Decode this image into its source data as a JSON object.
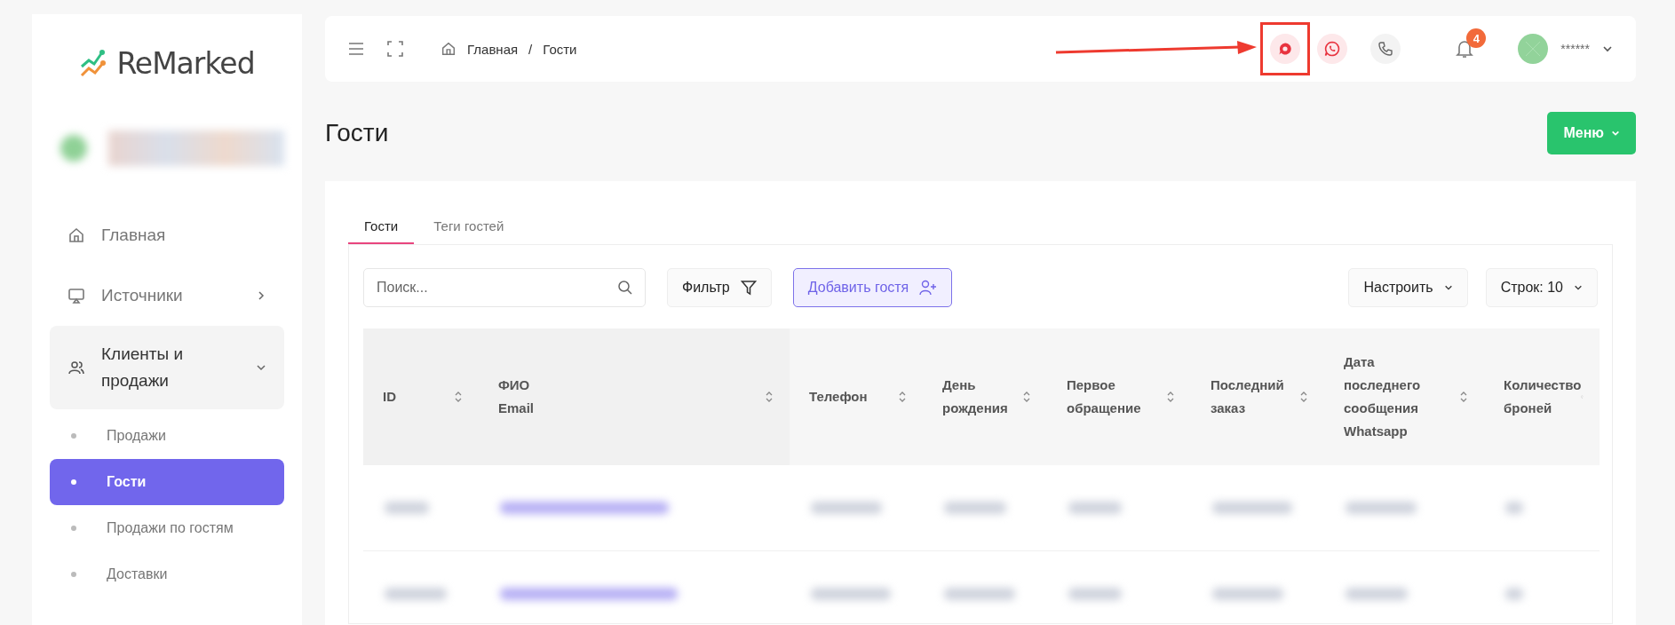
{
  "sidebar": {
    "logo": "ReMarked",
    "items": [
      {
        "label": "Главная",
        "kind": "home",
        "expanded": false
      },
      {
        "label": "Источники",
        "kind": "sources",
        "expanded": false
      },
      {
        "label": "Клиенты и продажи",
        "kind": "clients",
        "expanded": true,
        "children": [
          {
            "label": "Продажи",
            "selected": false
          },
          {
            "label": "Гости",
            "selected": true
          },
          {
            "label": "Продажи по гостям",
            "selected": false
          },
          {
            "label": "Доставки",
            "selected": false
          }
        ]
      }
    ]
  },
  "header": {
    "breadcrumbs": [
      "Главная",
      "Гости"
    ],
    "breadcrumb_separator": "/",
    "notification_count": "4",
    "user_name": "******"
  },
  "page": {
    "title": "Гости",
    "menu_button": "Меню"
  },
  "tabs": [
    {
      "label": "Гости",
      "selected": true
    },
    {
      "label": "Теги гостей",
      "selected": false
    }
  ],
  "toolbar": {
    "search_placeholder": "Поиск...",
    "filter": "Фильтр",
    "add_guest": "Добавить гостя",
    "configure": "Настроить",
    "rows_label": "Строк:",
    "rows_value": "10"
  },
  "table": {
    "columns": [
      {
        "lines": [
          "ID"
        ]
      },
      {
        "lines": [
          "ФИО",
          "Email"
        ]
      },
      {
        "lines": [
          "Телефон"
        ]
      },
      {
        "lines": [
          "День",
          "рождения"
        ]
      },
      {
        "lines": [
          "Первое",
          "обращение"
        ]
      },
      {
        "lines": [
          "Последний",
          "заказ"
        ]
      },
      {
        "lines": [
          "Дата",
          "последнего",
          "сообщения",
          "Whatsapp"
        ]
      },
      {
        "lines": [
          "Количество",
          "броней"
        ]
      }
    ]
  }
}
